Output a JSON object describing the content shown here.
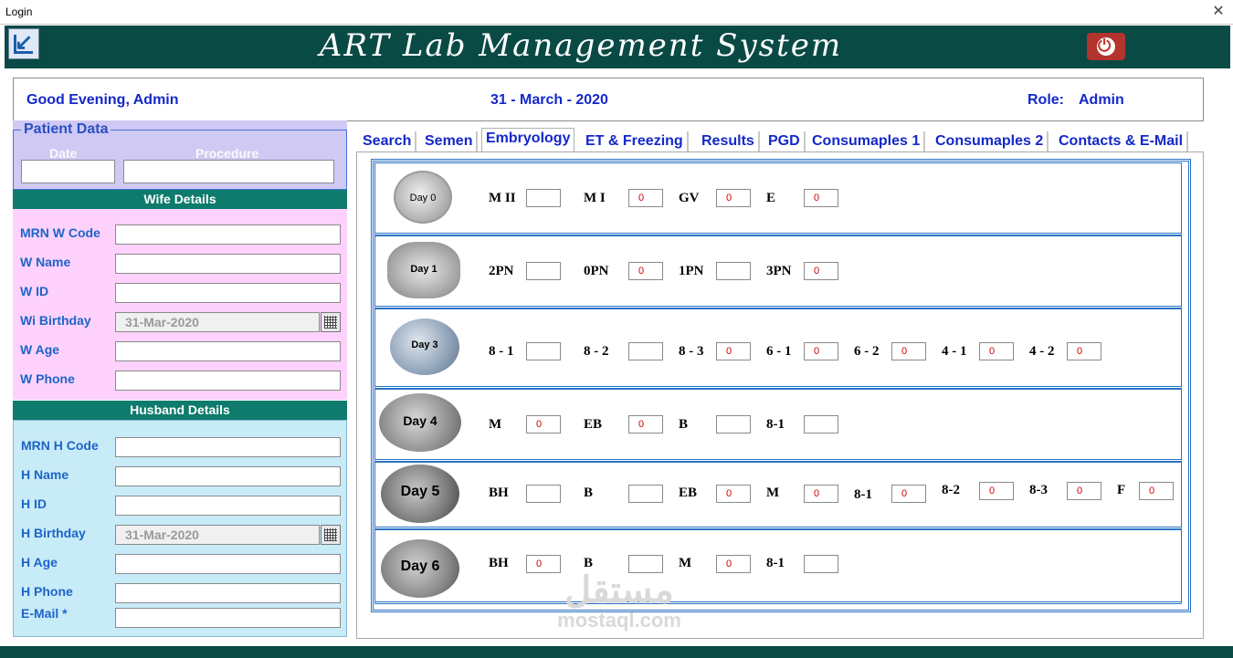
{
  "window": {
    "title": "Login"
  },
  "app": {
    "title": "ART Lab Management System"
  },
  "infobar": {
    "greeting": "Good Evening, Admin",
    "date": "31 - March - 2020",
    "role_label": "Role:",
    "role_value": "Admin"
  },
  "patient": {
    "legend": "Patient Data",
    "date_label": "Date",
    "procedure_label": "Procedure"
  },
  "wife": {
    "header": "Wife Details",
    "mrn_label": "MRN W Code",
    "name_label": "W Name",
    "id_label": "W ID",
    "birthday_label": "Wi Birthday",
    "birthday_value": "31-Mar-2020",
    "age_label": "W Age",
    "phone_label": "W Phone"
  },
  "husband": {
    "header": "Husband Details",
    "mrn_label": "MRN H Code",
    "name_label": "H Name",
    "id_label": "H ID",
    "birthday_label": "H Birthday",
    "birthday_value": "31-Mar-2020",
    "age_label": "H Age",
    "phone_label": "H Phone",
    "email_label": "E-Mail *"
  },
  "tabs": [
    "Search",
    "Semen",
    "Embryology",
    "ET & Freezing",
    "Results",
    "PGD",
    "Consumaples 1",
    "Consumaples 2",
    "Contacts & E-Mail"
  ],
  "days": [
    {
      "image_label": "Day 0",
      "fields": [
        {
          "label": "M II",
          "value": ""
        },
        {
          "label": "M I",
          "value": "0"
        },
        {
          "label": "GV",
          "value": "0"
        },
        {
          "label": "E",
          "value": "0"
        }
      ]
    },
    {
      "image_label": "Day 1",
      "fields": [
        {
          "label": "2PN",
          "value": ""
        },
        {
          "label": "0PN",
          "value": "0"
        },
        {
          "label": "1PN",
          "value": ""
        },
        {
          "label": "3PN",
          "value": "0"
        }
      ]
    },
    {
      "image_label": "Day 3",
      "fields": [
        {
          "label": "8 - 1",
          "value": ""
        },
        {
          "label": "8 - 2",
          "value": ""
        },
        {
          "label": "8 - 3",
          "value": "0"
        },
        {
          "label": "6 - 1",
          "value": "0"
        },
        {
          "label": "6 - 2",
          "value": "0"
        },
        {
          "label": "4 - 1",
          "value": "0"
        },
        {
          "label": "4 - 2",
          "value": "0"
        }
      ]
    },
    {
      "image_label": "Day 4",
      "fields": [
        {
          "label": "M",
          "value": "0"
        },
        {
          "label": "EB",
          "value": "0"
        },
        {
          "label": "B",
          "value": ""
        },
        {
          "label": "8-1",
          "value": ""
        }
      ]
    },
    {
      "image_label": "Day 5",
      "fields": [
        {
          "label": "BH",
          "value": ""
        },
        {
          "label": "B",
          "value": ""
        },
        {
          "label": "EB",
          "value": "0"
        },
        {
          "label": "M",
          "value": "0"
        },
        {
          "label": "8-1",
          "value": "0"
        },
        {
          "label": "8-2",
          "value": "0"
        },
        {
          "label": "8-3",
          "value": "0"
        },
        {
          "label": "F",
          "value": "0"
        }
      ]
    },
    {
      "image_label": "Day 6",
      "fields": [
        {
          "label": "BH",
          "value": "0"
        },
        {
          "label": "B",
          "value": ""
        },
        {
          "label": "M",
          "value": "0"
        },
        {
          "label": "8-1",
          "value": ""
        }
      ]
    }
  ],
  "watermark": {
    "arabic": "مستقل",
    "latin": "mostaql.com"
  }
}
